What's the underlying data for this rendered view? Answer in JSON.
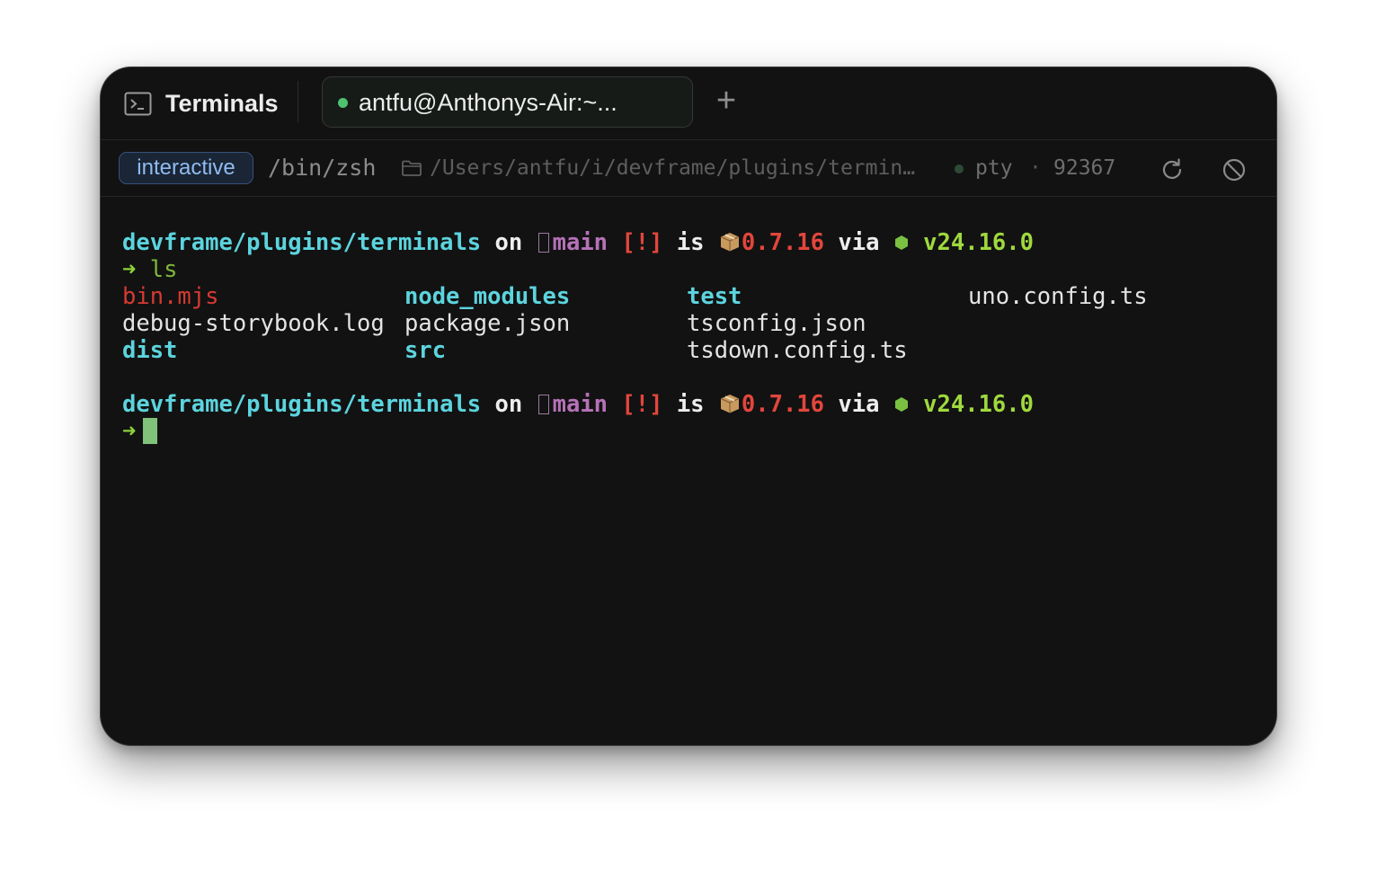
{
  "app": {
    "title": "Terminals",
    "icon": "terminal-icon"
  },
  "tabs": [
    {
      "label": "antfu@Anthonys-Air:~...",
      "status_color": "#4fc26f",
      "active": true
    }
  ],
  "new_tab_label": "+",
  "session": {
    "mode": "interactive",
    "shell": "/bin/zsh",
    "cwd": "/Users/antfu/i/devframe/plugins/termin…",
    "process_type": "pty",
    "separator": "·",
    "pid": "92367",
    "actions": [
      {
        "name": "restart",
        "icon": "refresh-icon"
      },
      {
        "name": "clear",
        "icon": "ban-icon"
      }
    ]
  },
  "terminal": {
    "prompts": [
      {
        "dir": "devframe/plugins/terminals",
        "on": "on",
        "branch_glyph": "",
        "branch": "main",
        "git_status": "[!]",
        "is": "is",
        "pkg_version": "0.7.16",
        "via": "via",
        "node_version": "v24.16.0"
      },
      {
        "dir": "devframe/plugins/terminals",
        "on": "on",
        "branch_glyph": "",
        "branch": "main",
        "git_status": "[!]",
        "is": "is",
        "pkg_version": "0.7.16",
        "via": "via",
        "node_version": "v24.16.0"
      }
    ],
    "arrow": "➜",
    "command": "ls",
    "ls_rows": [
      [
        "bin.mjs",
        "node_modules",
        "test",
        "uno.config.ts"
      ],
      [
        "debug-storybook.log",
        "package.json",
        "tsconfig.json",
        ""
      ],
      [
        "dist",
        "src",
        "tsdown.config.ts",
        ""
      ]
    ]
  },
  "colors": {
    "window_bg": "#121212",
    "dir": "#5cd4de",
    "branch": "#b672b8",
    "git_status": "#e2463c",
    "node": "#9fd93e",
    "cursor": "#7fc27a"
  }
}
